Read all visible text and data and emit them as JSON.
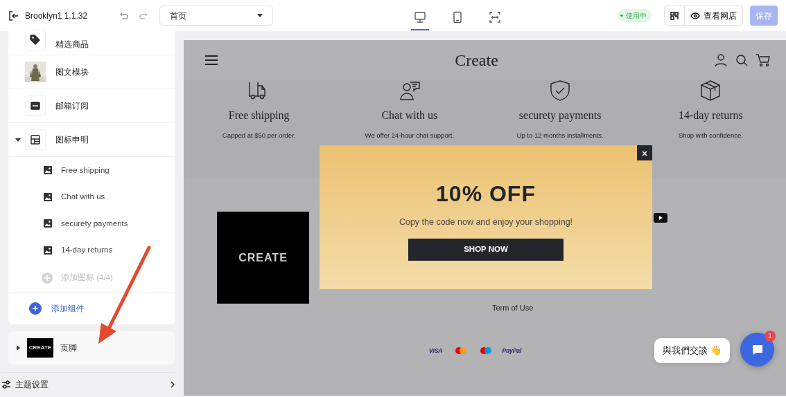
{
  "topbar": {
    "app_title": "Brooklyn1 1.1.32",
    "page_select": {
      "value": "首页"
    },
    "devices": [
      {
        "kind": "desktop",
        "selected": true
      },
      {
        "kind": "tablet",
        "selected": false
      },
      {
        "kind": "fullscreen",
        "selected": false
      }
    ],
    "status": "使用中",
    "view_store": "查看网店",
    "save": {
      "label": "保存",
      "disabled": true
    }
  },
  "sidebar": {
    "sections": [
      {
        "label": "精选商品"
      },
      {
        "label": "图文模块"
      },
      {
        "label": "邮箱订阅"
      },
      {
        "label": "图标申明",
        "expanded": true,
        "children": [
          {
            "label": "Free shipping"
          },
          {
            "label": "Chat with us"
          },
          {
            "label": "securety payments"
          },
          {
            "label": "14-day returns"
          }
        ],
        "add_item": {
          "label": "添加图标 (4/4)",
          "disabled": true
        }
      }
    ],
    "add_component": "添加组件",
    "footer_section": {
      "label": "页脚",
      "logo_text": "CREATE",
      "expanded": false
    },
    "theme_settings": "主题设置"
  },
  "preview": {
    "header": {
      "logo": "Create"
    },
    "features": [
      {
        "title": "Free shipping",
        "text": "Capped at $50 per order."
      },
      {
        "title": "Chat with us",
        "text": "We offer 24-hour chat support."
      },
      {
        "title": "securety payments",
        "text": "Up to 12 months installments."
      },
      {
        "title": "14-day returns",
        "text": "Shop with confidence."
      }
    ],
    "footer": {
      "logo": "CREATE",
      "links": [
        "Term of Use"
      ],
      "payments": [
        {
          "kind": "text",
          "label": "VISA"
        },
        {
          "kind": "mastercard"
        },
        {
          "kind": "maestro"
        },
        {
          "kind": "text",
          "label": "PayPal"
        }
      ]
    },
    "popup": {
      "title": "10% OFF",
      "text": "Copy the code now and enjoy your shopping!",
      "button": "SHOP NOW"
    },
    "chat": {
      "bubble": "與我們交談 👋",
      "badge": "1"
    }
  }
}
